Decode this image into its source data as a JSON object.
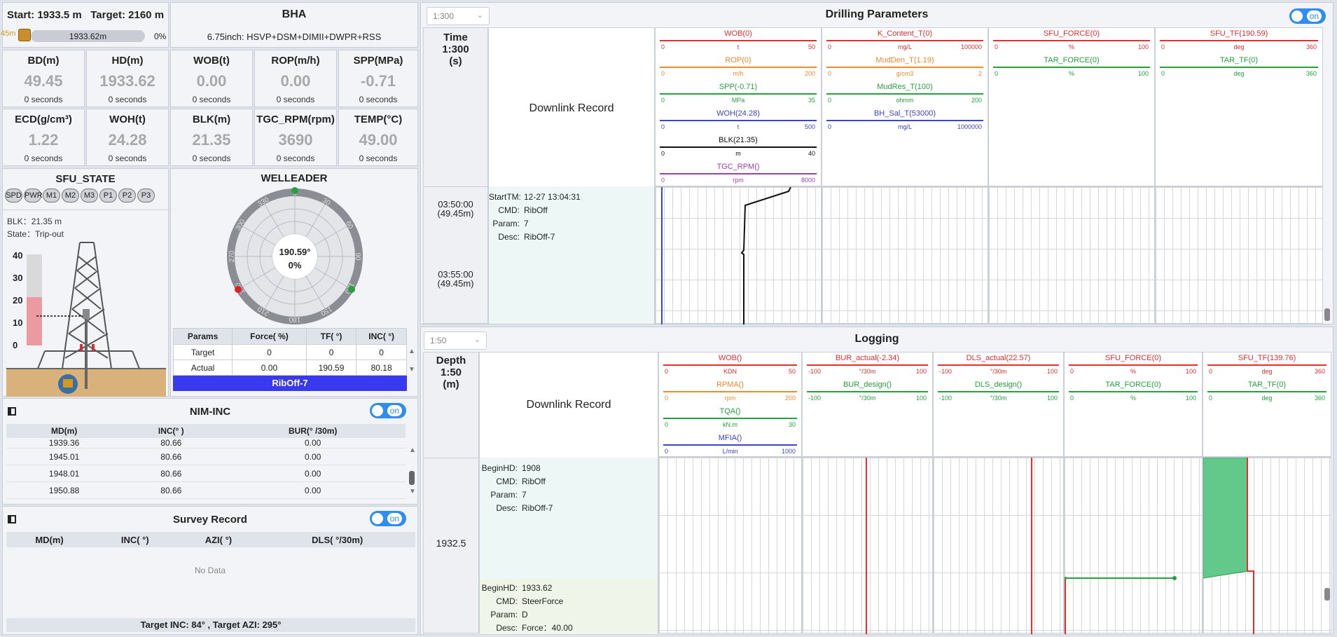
{
  "header": {
    "start_label": "Start:",
    "start_value": "1933.5 m",
    "target_label": "Target:",
    "target_value": "2160 m",
    "depth_marker": "45m",
    "progress_text": "1933.62m",
    "progress_percent": "0%",
    "progress_fraction": 0.0
  },
  "bha": {
    "title": "BHA",
    "desc": "6.75inch: HSVP+DSM+DIMII+DWPR+RSS"
  },
  "metrics": [
    {
      "title": "BD(m)",
      "value": "49.45",
      "sub": "0 seconds"
    },
    {
      "title": "HD(m)",
      "value": "1933.62",
      "sub": "0 seconds"
    },
    {
      "title": "WOB(t)",
      "value": "0.00",
      "sub": "0 seconds"
    },
    {
      "title": "ROP(m/h)",
      "value": "0.00",
      "sub": "0 seconds"
    },
    {
      "title": "SPP(MPa)",
      "value": "-0.71",
      "sub": "0 seconds"
    },
    {
      "title": "ECD(g/cm³)",
      "value": "1.22",
      "sub": "0 seconds"
    },
    {
      "title": "WOH(t)",
      "value": "24.28",
      "sub": "0 seconds"
    },
    {
      "title": "BLK(m)",
      "value": "21.35",
      "sub": "0 seconds"
    },
    {
      "title": "TGC_RPM(rpm)",
      "value": "3690",
      "sub": "0 seconds"
    },
    {
      "title": "TEMP(°C)",
      "value": "49.00",
      "sub": "0 seconds"
    }
  ],
  "sfu": {
    "title": "SFU_STATE",
    "buttons": [
      "SPD",
      "PWR",
      "M1",
      "M2",
      "M3",
      "P1",
      "P2",
      "P3"
    ],
    "blk_label": "BLK：",
    "blk_value": "21.35 m",
    "state_label": "State：",
    "state_value": "Trip-out",
    "scale": [
      "40",
      "30",
      "20",
      "10",
      "0"
    ],
    "blk_fraction": 0.53
  },
  "welleader": {
    "title": "WELLEADER",
    "angle_text": "190.59°",
    "percent_text": "0%",
    "dial_labels": [
      "0",
      "30",
      "60",
      "90",
      "120",
      "150",
      "180",
      "210",
      "240",
      "270",
      "300",
      "330"
    ],
    "table_headers": [
      "Params",
      "Force( %)",
      "TF( °)",
      "INC( °)"
    ],
    "rows": [
      {
        "name": "Target",
        "force": "0",
        "tf": "0",
        "inc": "0"
      },
      {
        "name": "Actual",
        "force": "0.00",
        "tf": "190.59",
        "inc": "80.18"
      }
    ],
    "banner": "RibOff-7"
  },
  "nim_inc": {
    "title": "NIM-INC",
    "toggle": "on",
    "headers": [
      "MD(m)",
      "INC(° )",
      "BUR(° /30m)"
    ],
    "rows": [
      [
        "1939.36",
        "80.66",
        "0.00"
      ],
      [
        "1945.01",
        "80.66",
        "0.00"
      ],
      [
        "1948.01",
        "80.66",
        "0.00"
      ],
      [
        "1950.88",
        "80.66",
        "0.00"
      ]
    ]
  },
  "survey": {
    "title": "Survey Record",
    "toggle": "on",
    "headers": [
      "MD(m)",
      "INC( °)",
      "AZI( °)",
      "DLS( °/30m)"
    ],
    "empty": "No Data",
    "footer": "Target INC: 84° , Target AZI: 295°"
  },
  "drilling": {
    "title": "Drilling Parameters",
    "scale_select": "1:300",
    "toggle": "on",
    "time_title": "Time",
    "time_scale": "1:300",
    "time_unit": "(s)",
    "downlink_label": "Downlink Record",
    "curves": [
      [
        {
          "name": "WOB(0)",
          "lo": "0",
          "unit": "t",
          "hi": "50",
          "color": "#e03030"
        },
        {
          "name": "ROP(0)",
          "lo": "0",
          "unit": "m/h",
          "hi": "200",
          "color": "#f08a30"
        },
        {
          "name": "SPP(-0.71)",
          "lo": "0",
          "unit": "MPa",
          "hi": "35",
          "color": "#27a040"
        },
        {
          "name": "WOH(24.28)",
          "lo": "0",
          "unit": "t",
          "hi": "500",
          "color": "#3a45c8"
        },
        {
          "name": "BLK(21.35)",
          "lo": "0",
          "unit": "m",
          "hi": "40",
          "color": "#111111"
        },
        {
          "name": "TGC_RPM()",
          "lo": "0",
          "unit": "rpm",
          "hi": "8000",
          "color": "#a040b0"
        }
      ],
      [
        {
          "name": "K_Content_T(0)",
          "lo": "0",
          "unit": "mg/L",
          "hi": "100000",
          "color": "#e03030"
        },
        {
          "name": "MudDen_T(1.19)",
          "lo": "0",
          "unit": "g/cm3",
          "hi": "2",
          "color": "#f08a30"
        },
        {
          "name": "MudRes_T(100)",
          "lo": "0",
          "unit": "ohmm",
          "hi": "200",
          "color": "#27a040"
        },
        {
          "name": "BH_Sal_T(53000)",
          "lo": "0",
          "unit": "mg/L",
          "hi": "1000000",
          "color": "#3a45c8"
        }
      ],
      [
        {
          "name": "SFU_FORCE(0)",
          "lo": "0",
          "unit": "%",
          "hi": "100",
          "color": "#e03030"
        },
        {
          "name": "TAR_FORCE(0)",
          "lo": "0",
          "unit": "%",
          "hi": "100",
          "color": "#27a040"
        }
      ],
      [
        {
          "name": "SFU_TF(190.59)",
          "lo": "0",
          "unit": "deg",
          "hi": "360",
          "color": "#e03030"
        },
        {
          "name": "TAR_TF(0)",
          "lo": "0",
          "unit": "deg",
          "hi": "360",
          "color": "#27a040"
        }
      ]
    ],
    "time_rows": [
      {
        "time": "03:50:00",
        "depth": "(49.45m)"
      },
      {
        "time": "03:55:00",
        "depth": "(49.45m)"
      }
    ],
    "record": {
      "start_label": "StartTM:",
      "start": "12-27 13:04:31",
      "cmd_label": "CMD:",
      "cmd": "RibOff",
      "param_label": "Param:",
      "param": "7",
      "desc_label": "Desc:",
      "desc": "RibOff-7"
    }
  },
  "logging": {
    "title": "Logging",
    "scale_select": "1:50",
    "depth_title": "Depth",
    "depth_scale": "1:50",
    "depth_unit": "(m)",
    "downlink_label": "Downlink Record",
    "depth_value": "1932.5",
    "curves": [
      [
        {
          "name": "WOB()",
          "lo": "0",
          "unit": "KDN",
          "hi": "50",
          "color": "#e03030"
        },
        {
          "name": "RPMA()",
          "lo": "0",
          "unit": "rpm",
          "hi": "200",
          "color": "#f08a30"
        },
        {
          "name": "TQA()",
          "lo": "0",
          "unit": "kN.m",
          "hi": "30",
          "color": "#27a040"
        },
        {
          "name": "MFIA()",
          "lo": "0",
          "unit": "L/min",
          "hi": "1000",
          "color": "#3a45c8"
        }
      ],
      [
        {
          "name": "BUR_actual(-2.34)",
          "lo": "-100",
          "unit": "°/30m",
          "hi": "100",
          "color": "#e03030"
        },
        {
          "name": "BUR_design()",
          "lo": "-100",
          "unit": "°/30m",
          "hi": "100",
          "color": "#27a040"
        }
      ],
      [
        {
          "name": "DLS_actual(22.57)",
          "lo": "-100",
          "unit": "°/30m",
          "hi": "100",
          "color": "#e03030"
        },
        {
          "name": "DLS_design()",
          "lo": "-100",
          "unit": "°/30m",
          "hi": "100",
          "color": "#27a040"
        }
      ],
      [
        {
          "name": "SFU_FORCE(0)",
          "lo": "0",
          "unit": "%",
          "hi": "100",
          "color": "#e03030"
        },
        {
          "name": "TAR_FORCE(0)",
          "lo": "0",
          "unit": "%",
          "hi": "100",
          "color": "#27a040"
        }
      ],
      [
        {
          "name": "SFU_TF(139.76)",
          "lo": "0",
          "unit": "deg",
          "hi": "360",
          "color": "#e03030"
        },
        {
          "name": "TAR_TF(0)",
          "lo": "0",
          "unit": "deg",
          "hi": "360",
          "color": "#27a040"
        }
      ]
    ],
    "records": [
      {
        "hd_label": "BeginHD:",
        "hd": "1908",
        "cmd_label": "CMD:",
        "cmd": "RibOff",
        "param_label": "Param:",
        "param": "7",
        "desc_label": "Desc:",
        "desc": "RibOff-7"
      },
      {
        "hd_label": "BeginHD:",
        "hd": "1933.62",
        "cmd_label": "CMD:",
        "cmd": "SteerForce",
        "param_label": "Param:",
        "param": "D",
        "desc_label": "Desc:",
        "desc": "Force：40.00"
      }
    ]
  }
}
